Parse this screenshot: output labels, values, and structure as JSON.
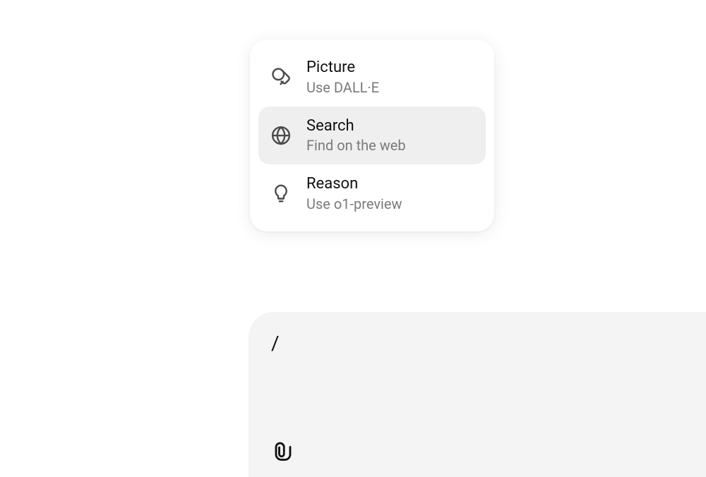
{
  "menu": {
    "items": [
      {
        "title": "Picture",
        "subtitle": "Use DALL·E",
        "highlighted": false
      },
      {
        "title": "Search",
        "subtitle": "Find on the web",
        "highlighted": true
      },
      {
        "title": "Reason",
        "subtitle": "Use o1-preview",
        "highlighted": false
      }
    ]
  },
  "input": {
    "text": "/"
  }
}
